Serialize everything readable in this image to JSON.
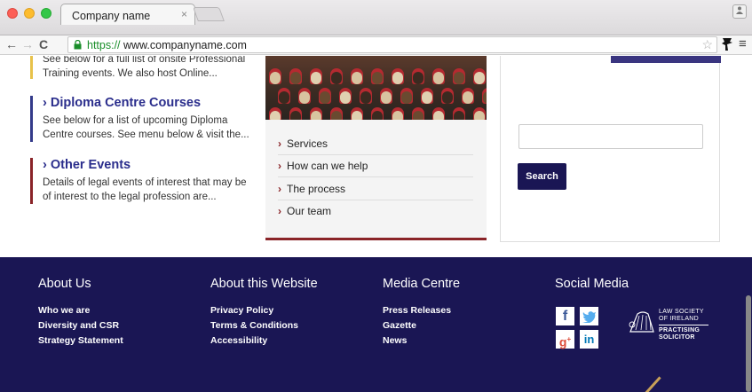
{
  "browser": {
    "tab_title": "Company name",
    "tab_close": "×",
    "url_scheme": "https://",
    "url_host": " www.companyname.com"
  },
  "news": [
    {
      "title": "",
      "desc": "See below for a full list of onsite Professional Training events. We also host Online...",
      "accent": "#e8c24a"
    },
    {
      "title": "› Diploma Centre Courses",
      "desc": "See below for a list of upcoming Diploma Centre courses. See menu below & visit the...",
      "accent": "#333a8a"
    },
    {
      "title": "› Other Events",
      "desc": "Details of legal events of interest that may be of interest to the legal profession are...",
      "accent": "#8a2428"
    }
  ],
  "services": {
    "links": [
      "Services",
      "How can we help",
      "The process",
      "Our team"
    ],
    "chevron": "›"
  },
  "search": {
    "button": "Search",
    "placeholder": ""
  },
  "footer": {
    "about": {
      "heading": "About Us",
      "links": [
        "Who we are",
        "Diversity and CSR",
        "Strategy Statement"
      ]
    },
    "website": {
      "heading": "About this Website",
      "links": [
        "Privacy Policy",
        "Terms & Conditions",
        "Accessibility"
      ]
    },
    "media": {
      "heading": "Media Centre",
      "links": [
        "Press Releases",
        "Gazette",
        "News"
      ]
    },
    "social": {
      "heading": "Social Media",
      "icons": [
        "facebook-icon",
        "twitter-icon",
        "google-plus-icon",
        "linkedin-icon"
      ]
    },
    "law_logo": [
      "LAW SOCIETY",
      "OF IRELAND",
      "PRACTISING",
      "SOLICITOR"
    ]
  },
  "colors": {
    "footer_bg": "#1a1654",
    "accent_red": "#8a2428",
    "accent_blue": "#2a2d8c"
  }
}
